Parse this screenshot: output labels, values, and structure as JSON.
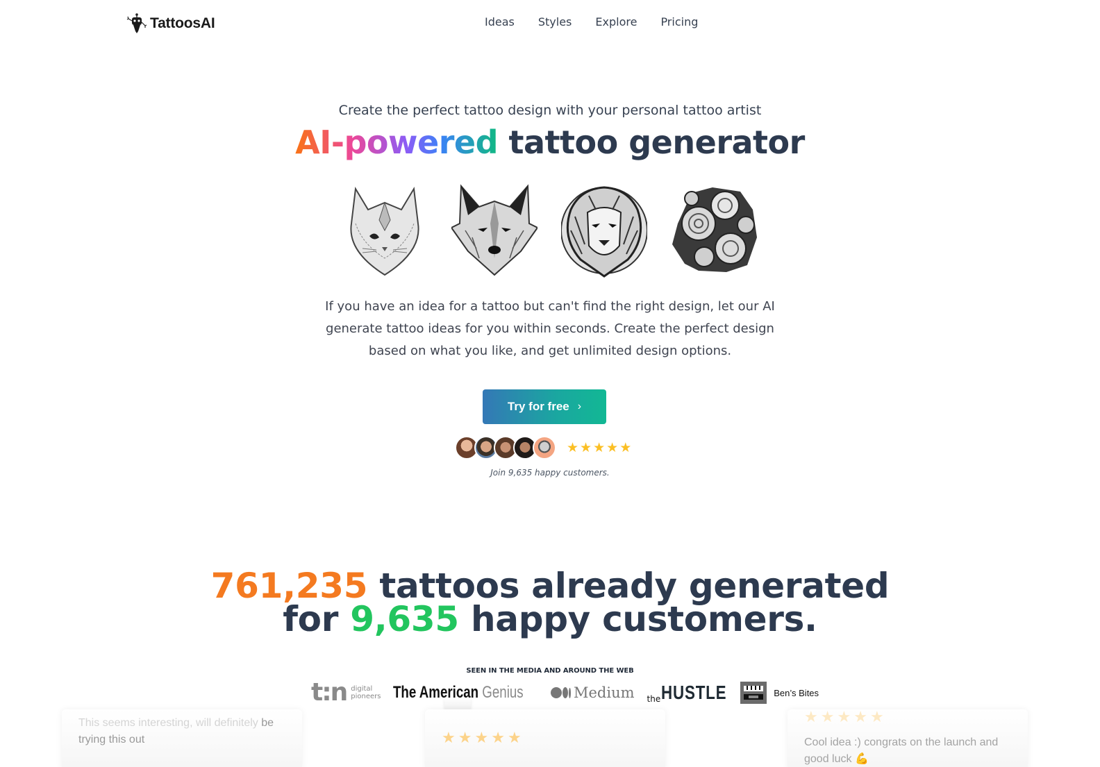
{
  "header": {
    "logo_text": "TattoosAI",
    "nav": [
      "Ideas",
      "Styles",
      "Explore",
      "Pricing"
    ]
  },
  "hero": {
    "subtitle": "Create the perfect tattoo design with your personal tattoo artist",
    "headline_gradient": "AI-powered",
    "headline_rest": " tattoo generator",
    "gallery": [
      {
        "name": "cat",
        "alt": "cat tattoo"
      },
      {
        "name": "wolf",
        "alt": "wolf tattoo"
      },
      {
        "name": "lion",
        "alt": "lion tattoo"
      },
      {
        "name": "roses",
        "alt": "roses tattoo"
      }
    ],
    "description": "If you have an idea for a tattoo but can't find the right design, let our AI generate tattoo ideas for you within seconds. Create the perfect design based on what you like, and get unlimited design options.",
    "cta_label": "Try for free",
    "cta_chevron": "›",
    "rating_stars": 5,
    "star_glyph": "★",
    "join_text": "Join 9,635 happy customers."
  },
  "stats": {
    "tattoos_count": "761,235",
    "line1_rest": " tattoos already generated",
    "line2_prefix": "for ",
    "customers_count": "9,635",
    "line2_rest": " happy customers."
  },
  "media": {
    "title": "SEEN IN THE MEDIA AND AROUND THE WEB",
    "t3n_mark": "t:n",
    "t3n_line1": "digital",
    "t3n_line2": "pioneers",
    "amg_bold": "The American",
    "amg_light": " Genius",
    "medium": "Medium",
    "hustle_the": "the",
    "hustle": "HUSTLE",
    "bens_bites": "Ben’s Bites"
  },
  "testimonials": [
    {
      "text_faint": "This seems interesting, will definitely",
      "text": "be trying this out"
    },
    {
      "stars": 5
    },
    {
      "stars": 5,
      "text": "Cool idea :) congrats on the launch and good luck 💪"
    }
  ],
  "colors": {
    "orange": "#f47a20",
    "green": "#22c55e",
    "heading": "#2d3a4f",
    "star": "#fbbf24"
  }
}
